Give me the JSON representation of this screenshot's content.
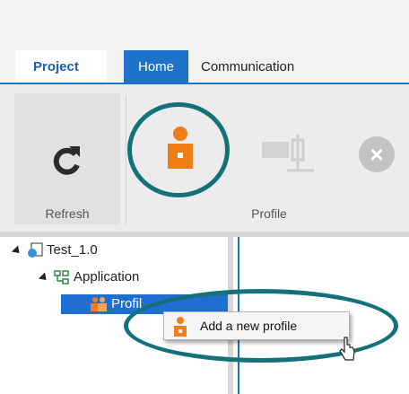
{
  "ribbon": {
    "tabs": [
      {
        "label": "Project",
        "state": "file-tab"
      },
      {
        "label": "Home",
        "state": "active"
      },
      {
        "label": "Communication",
        "state": "inactive"
      }
    ],
    "groups": {
      "refresh": {
        "label": "Refresh",
        "icon": "refresh-icon"
      },
      "profile": {
        "label": "Profile",
        "icons": [
          "add-profile-icon",
          "device-profile-icon",
          "close-icon"
        ]
      }
    }
  },
  "tree": {
    "nodes": [
      {
        "label": "Test_1.0",
        "icon": "project-globe-icon",
        "expanded": true
      },
      {
        "label": "Application",
        "icon": "application-tree-icon",
        "expanded": true
      },
      {
        "label": "Profil",
        "icon": "profiles-icon",
        "selected": true
      }
    ]
  },
  "context_menu": {
    "items": [
      {
        "label": "Add a new profile",
        "icon": "add-profile-icon"
      }
    ]
  },
  "colors": {
    "accent_blue": "#1e73c9",
    "highlight_ring": "#13717a",
    "profile_orange": "#f07d18",
    "selection_blue": "#1f6fd0"
  }
}
